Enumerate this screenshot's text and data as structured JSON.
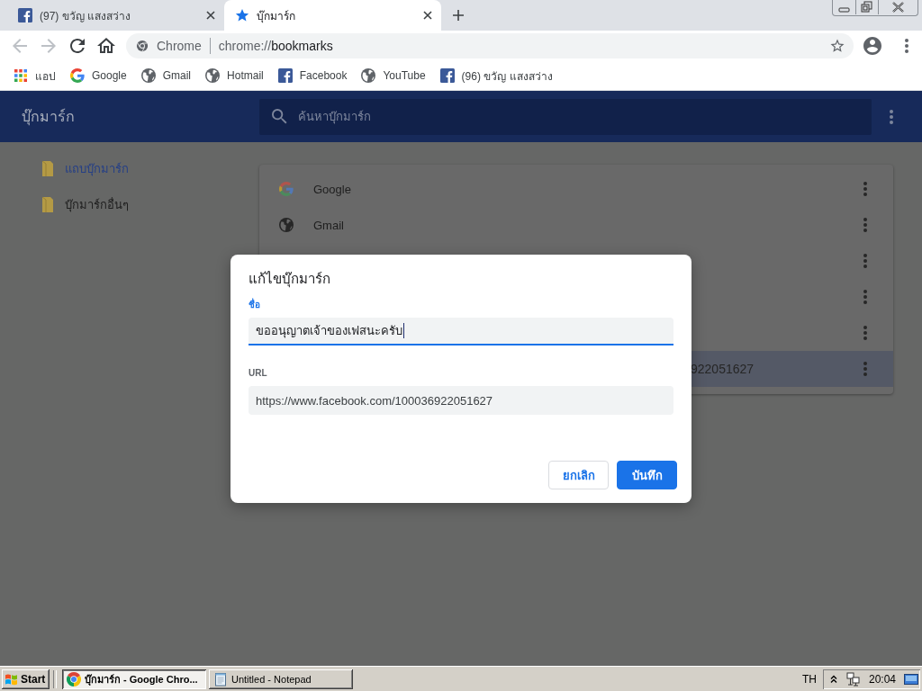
{
  "tabs": [
    {
      "kind": "facebook",
      "title": "(97) ขวัญ แสงสว่าง",
      "selected": false
    },
    {
      "kind": "star",
      "title": "บุ๊กมาร์ก",
      "selected": true
    }
  ],
  "toolbar": {
    "nav_buttons": [
      {
        "kind": "back",
        "disabled": true
      },
      {
        "kind": "forward",
        "disabled": true
      },
      {
        "kind": "reload",
        "disabled": false
      },
      {
        "kind": "home",
        "disabled": false
      }
    ],
    "omnibox": {
      "site_label": "Chrome",
      "url_scheme": "chrome://",
      "url_path": "bookmarks"
    }
  },
  "bookmarks_bar": [
    {
      "kind": "apps",
      "label": "แอป"
    },
    {
      "kind": "google",
      "label": "Google"
    },
    {
      "kind": "globe",
      "label": "Gmail"
    },
    {
      "kind": "globe",
      "label": "Hotmail"
    },
    {
      "kind": "facebook",
      "label": "Facebook"
    },
    {
      "kind": "globe",
      "label": "YouTube"
    },
    {
      "kind": "facebook",
      "label": "(96) ขวัญ แสงสว่าง"
    }
  ],
  "app_header": {
    "title": "บุ๊กมาร์ก",
    "search": {
      "placeholder": "ค้นหาบุ๊กมาร์ก"
    }
  },
  "sidebar": {
    "items": [
      {
        "label": "แถบบุ๊กมาร์ก",
        "selected": true
      },
      {
        "label": "บุ๊กมาร์กอื่นๆ",
        "selected": false
      }
    ]
  },
  "bookmark_list": {
    "rows": [
      {
        "kind": "google",
        "title": "Google",
        "selected": false
      },
      {
        "kind": "globe",
        "title": "Gmail",
        "selected": false
      },
      {
        "kind": "covered",
        "selected": false
      },
      {
        "kind": "covered",
        "selected": false
      },
      {
        "kind": "covered",
        "selected": false
      },
      {
        "kind": "cut",
        "title": "922051627",
        "selected": true
      }
    ]
  },
  "dialog": {
    "title": "แก้ไขบุ๊กมาร์ก",
    "fields": [
      {
        "label": "ชื่อ",
        "value": "ขออนุญาตเจ้าของเฟสนะครับ",
        "focused": true
      },
      {
        "label": "URL",
        "value": "https://www.facebook.com/100036922051627",
        "focused": false
      }
    ],
    "buttons": [
      {
        "kind": "secondary",
        "label": "ยกเลิก"
      },
      {
        "kind": "primary",
        "label": "บันทึก"
      }
    ]
  },
  "taskbar": {
    "start": "Start",
    "tasks": [
      {
        "kind": "chrome",
        "label": "บุ๊กมาร์ก - Google Chro...",
        "selected": true
      },
      {
        "kind": "notepad",
        "label": "Untitled - Notepad",
        "selected": false
      }
    ],
    "language": "TH",
    "clock": "20:04"
  }
}
